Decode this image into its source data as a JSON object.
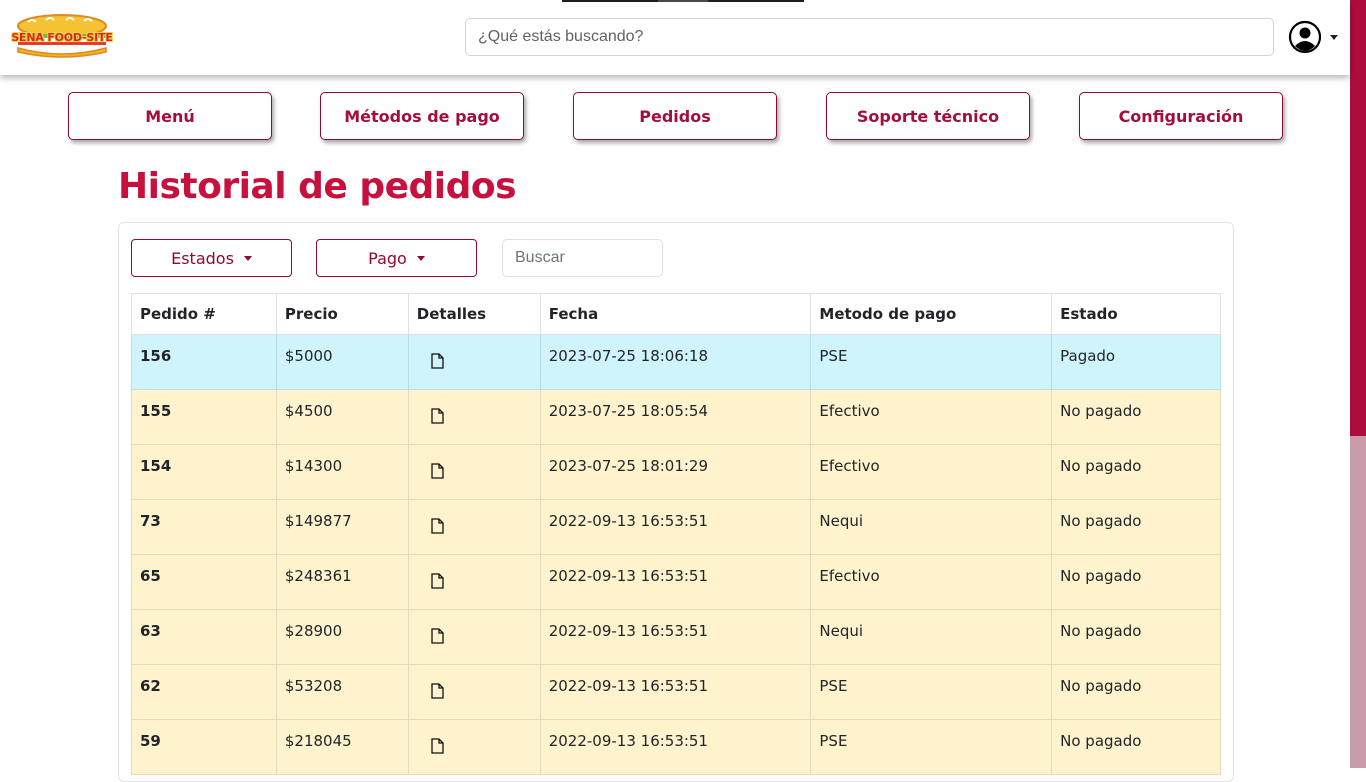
{
  "header": {
    "logo_text": "SENA FOOD-SITE",
    "search_placeholder": "¿Qué estás buscando?"
  },
  "nav": [
    "Menú",
    "Métodos de pago",
    "Pedidos",
    "Soporte técnico",
    "Configuración"
  ],
  "page_title": "Historial de pedidos",
  "filters": {
    "estados_label": "Estados",
    "pago_label": "Pago",
    "search_placeholder": "Buscar"
  },
  "table": {
    "headers": [
      "Pedido #",
      "Precio",
      "Detalles",
      "Fecha",
      "Metodo de pago",
      "Estado"
    ],
    "rows": [
      {
        "pedido": "156",
        "precio": "$5000",
        "fecha": "2023-07-25 18:06:18",
        "metodo": "PSE",
        "estado": "Pagado"
      },
      {
        "pedido": "155",
        "precio": "$4500",
        "fecha": "2023-07-25 18:05:54",
        "metodo": "Efectivo",
        "estado": "No pagado"
      },
      {
        "pedido": "154",
        "precio": "$14300",
        "fecha": "2023-07-25 18:01:29",
        "metodo": "Efectivo",
        "estado": "No pagado"
      },
      {
        "pedido": "73",
        "precio": "$149877",
        "fecha": "2022-09-13 16:53:51",
        "metodo": "Nequi",
        "estado": "No pagado"
      },
      {
        "pedido": "65",
        "precio": "$248361",
        "fecha": "2022-09-13 16:53:51",
        "metodo": "Efectivo",
        "estado": "No pagado"
      },
      {
        "pedido": "63",
        "precio": "$28900",
        "fecha": "2022-09-13 16:53:51",
        "metodo": "Nequi",
        "estado": "No pagado"
      },
      {
        "pedido": "62",
        "precio": "$53208",
        "fecha": "2022-09-13 16:53:51",
        "metodo": "PSE",
        "estado": "No pagado"
      },
      {
        "pedido": "59",
        "precio": "$218045",
        "fecha": "2022-09-13 16:53:51",
        "metodo": "PSE",
        "estado": "No pagado"
      }
    ]
  },
  "colors": {
    "brand": "#a50e3a",
    "title": "#c8103e",
    "paid_row": "#cff4fc",
    "unpaid_row": "#fff3cd"
  },
  "icons": [
    "user-circle-icon",
    "document-icon"
  ]
}
